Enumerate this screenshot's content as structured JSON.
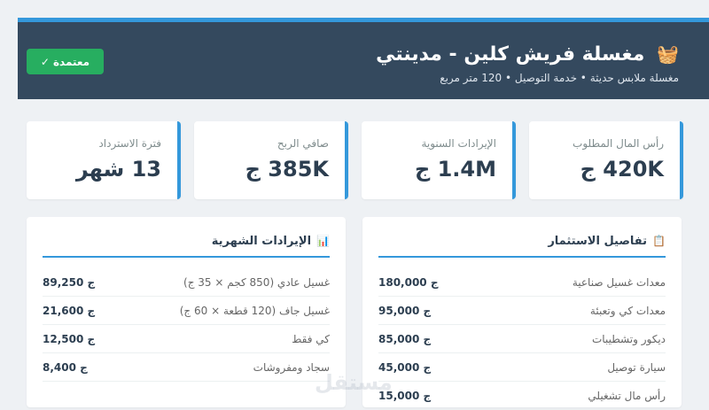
{
  "header": {
    "icon": "🧺",
    "title": "مغسلة فريش كلين - مدينتي",
    "subtitle": "مغسلة ملابس حديثة • خدمة التوصيل • 120 متر مربع",
    "badge": "معتمدة",
    "badge_icon": "✓"
  },
  "stats": [
    {
      "label": "رأس المال المطلوب",
      "value": "420K ج"
    },
    {
      "label": "الإيرادات السنوية",
      "value": "1.4M ج"
    },
    {
      "label": "صافي الربح",
      "value": "385K ج"
    },
    {
      "label": "فترة الاسترداد",
      "value": "13 شهر"
    }
  ],
  "investment": {
    "icon": "📋",
    "title": "تفاصيل الاستثمار",
    "rows": [
      {
        "label": "معدات غسيل صناعية",
        "value": "180,000 ج"
      },
      {
        "label": "معدات كي وتعبئة",
        "value": "95,000 ج"
      },
      {
        "label": "ديكور وتشطيبات",
        "value": "85,000 ج"
      },
      {
        "label": "سيارة توصيل",
        "value": "45,000 ج"
      },
      {
        "label": "رأس مال تشغيلي",
        "value": "15,000 ج"
      }
    ]
  },
  "revenue": {
    "icon": "📊",
    "title": "الإيرادات الشهرية",
    "rows": [
      {
        "label": "غسيل عادي (850 كجم × 35 ج)",
        "value": "89,250 ج"
      },
      {
        "label": "غسيل جاف (120 قطعة × 60 ج)",
        "value": "21,600 ج"
      },
      {
        "label": "كي فقط",
        "value": "12,500 ج"
      },
      {
        "label": "سجاد ومفروشات",
        "value": "8,400 ج"
      }
    ]
  },
  "watermark": "مستقل",
  "colors": {
    "header_bg": "#34495e",
    "accent": "#3498db",
    "badge_green": "#27ae60"
  }
}
